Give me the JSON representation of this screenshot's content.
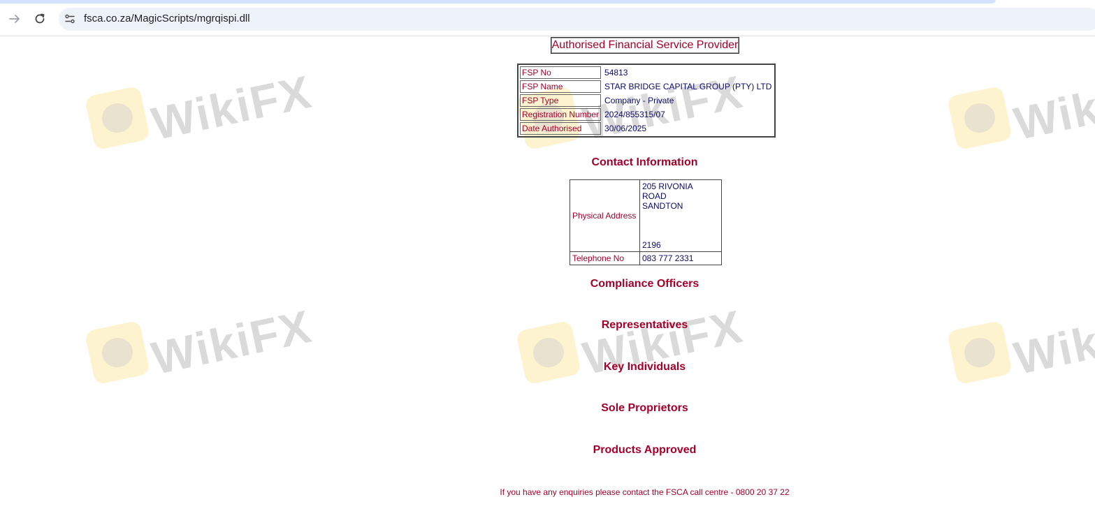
{
  "browser": {
    "url": "fsca.co.za/MagicScripts/mgrqispi.dll"
  },
  "watermark": {
    "text": "WikiFX"
  },
  "page": {
    "title": "Authorised Financial Service Provider",
    "fsp_details": [
      {
        "label": "FSP No",
        "value": "54813"
      },
      {
        "label": "FSP Name",
        "value": "STAR BRIDGE CAPITAL GROUP (PTY) LTD"
      },
      {
        "label": "FSP Type",
        "value": "Company - Private"
      },
      {
        "label": "Registration Number",
        "value": "2024/855315/07"
      },
      {
        "label": "Date Authorised",
        "value": "30/06/2025"
      }
    ],
    "contact": {
      "heading": "Contact Information",
      "physical_address_label": "Physical Address",
      "address_line1": "205 RIVONIA ROAD",
      "address_line2": "SANDTON",
      "postal_code": "2196",
      "telephone_label": "Telephone No",
      "telephone": "083 777 2331"
    },
    "sections": [
      "Compliance Officers",
      "Representatives",
      "Key Individuals",
      "Sole Proprietors",
      "Products Approved"
    ],
    "footer": "If you have any enquiries please contact the FSCA call centre - 0800 20 37 22"
  },
  "colors": {
    "label_red": "#a5002a",
    "value_navy": "#0a0a6a"
  }
}
